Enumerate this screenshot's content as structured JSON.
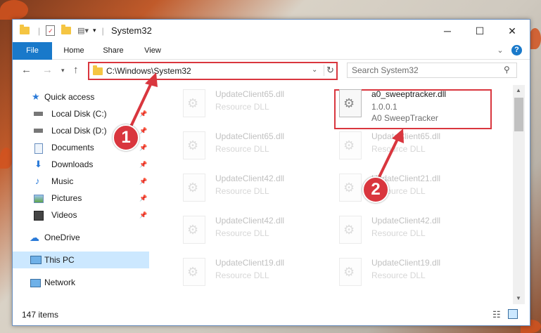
{
  "window": {
    "title": "System32",
    "controls": {
      "minimize": "─",
      "maximize": "☐",
      "close": "✕"
    }
  },
  "ribbon": {
    "tabs": [
      "File",
      "Home",
      "Share",
      "View"
    ],
    "help": "?",
    "collapse": "⌄"
  },
  "address": {
    "path": "C:\\Windows\\System32",
    "search_placeholder": "Search System32"
  },
  "nav": {
    "items": [
      {
        "label": "Quick access"
      },
      {
        "label": "Local Disk (C:)"
      },
      {
        "label": "Local Disk (D:)"
      },
      {
        "label": "Documents"
      },
      {
        "label": "Downloads"
      },
      {
        "label": "Music"
      },
      {
        "label": "Pictures"
      },
      {
        "label": "Videos"
      },
      {
        "label": "OneDrive"
      },
      {
        "label": "This PC"
      },
      {
        "label": "Network"
      }
    ]
  },
  "files": {
    "left": [
      {
        "name": "UpdateClient65.dll",
        "type": "Resource DLL"
      },
      {
        "name": "UpdateClient65.dll",
        "type": "Resource DLL"
      },
      {
        "name": "UpdateClient42.dll",
        "type": "Resource DLL"
      },
      {
        "name": "UpdateClient42.dll",
        "type": "Resource DLL"
      },
      {
        "name": "UpdateClient19.dll",
        "type": "Resource DLL"
      }
    ],
    "right": [
      {
        "name": "a0_sweeptracker.dll",
        "version": "1.0.0.1",
        "type": "A0 SweepTracker"
      },
      {
        "name": "UpdateClient65.dll",
        "type": "Resource DLL"
      },
      {
        "name": "UpdateClient21.dll",
        "type": "Resource DLL"
      },
      {
        "name": "UpdateClient42.dll",
        "type": "Resource DLL"
      },
      {
        "name": "UpdateClient19.dll",
        "type": "Resource DLL"
      }
    ]
  },
  "status": {
    "count": "147 items"
  },
  "callouts": [
    "1",
    "2"
  ],
  "colors": {
    "accent": "#1979ca",
    "highlight": "#d9363e"
  }
}
